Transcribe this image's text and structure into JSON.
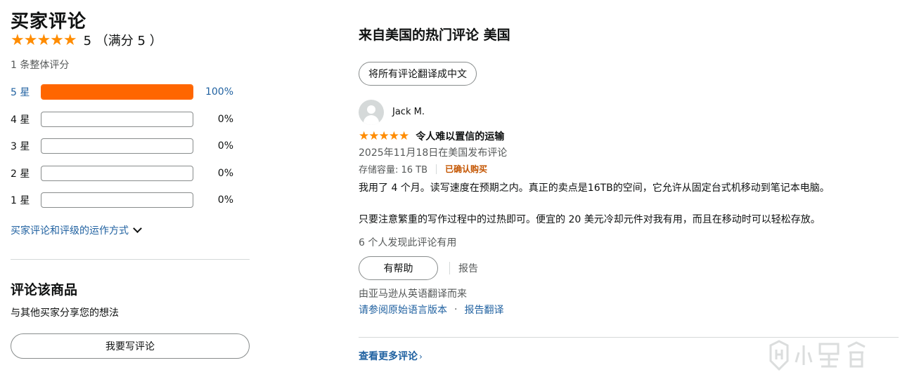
{
  "left": {
    "title": "买家评论",
    "stars": "★★★★★",
    "rating_text": "5 （满分 5 ）",
    "total_count": "1 条整体评分",
    "histogram": [
      {
        "label": "5 星",
        "percent_text": "100%",
        "fraction": 1.0
      },
      {
        "label": "4 星",
        "percent_text": "0%",
        "fraction": 0.0
      },
      {
        "label": "3 星",
        "percent_text": "0%",
        "fraction": 0.0
      },
      {
        "label": "2 星",
        "percent_text": "0%",
        "fraction": 0.0
      },
      {
        "label": "1 星",
        "percent_text": "0%",
        "fraction": 0.0
      }
    ],
    "how_link": "买家评论和评级的运作方式",
    "review_section_title": "评论该商品",
    "review_section_sub": "与其他买家分享您的想法",
    "write_button": "我要写评论"
  },
  "right": {
    "heading": "来自美国的热门评论 美国",
    "translate_button": "将所有评论翻译成中文",
    "review": {
      "reviewer": "Jack M.",
      "stars": "★★★★★",
      "title": "令人难以置信的运输",
      "date": "2025年11月18日在美国发布评论",
      "capacity": "存储容量: 16 TB",
      "verified": "已确认购买",
      "body_line1": "我用了 4 个月。读写速度在预期之内。真正的卖点是16TB的空间，它允许从固定台式机移动到笔记本电脑。",
      "body_line2": "只要注意繁重的写作过程中的过热即可。便宜的 20 美元冷却元件对我有用，而且在移动时可以轻松存放。",
      "helpful_count": "6 个人发现此评论有用",
      "helpful_button": "有帮助",
      "report": "报告",
      "translated_note": "由亚马逊从英语翻译而来",
      "original_link": "请参阅原始语言版本",
      "dot": "·",
      "report_translation": "报告翻译"
    },
    "more_reviews": "查看更多评论",
    "more_arrow": "›"
  },
  "colors": {
    "star": "#ff8c00",
    "bar_fill": "#ff6600",
    "link": "#2162a1",
    "verified": "#c45500"
  }
}
